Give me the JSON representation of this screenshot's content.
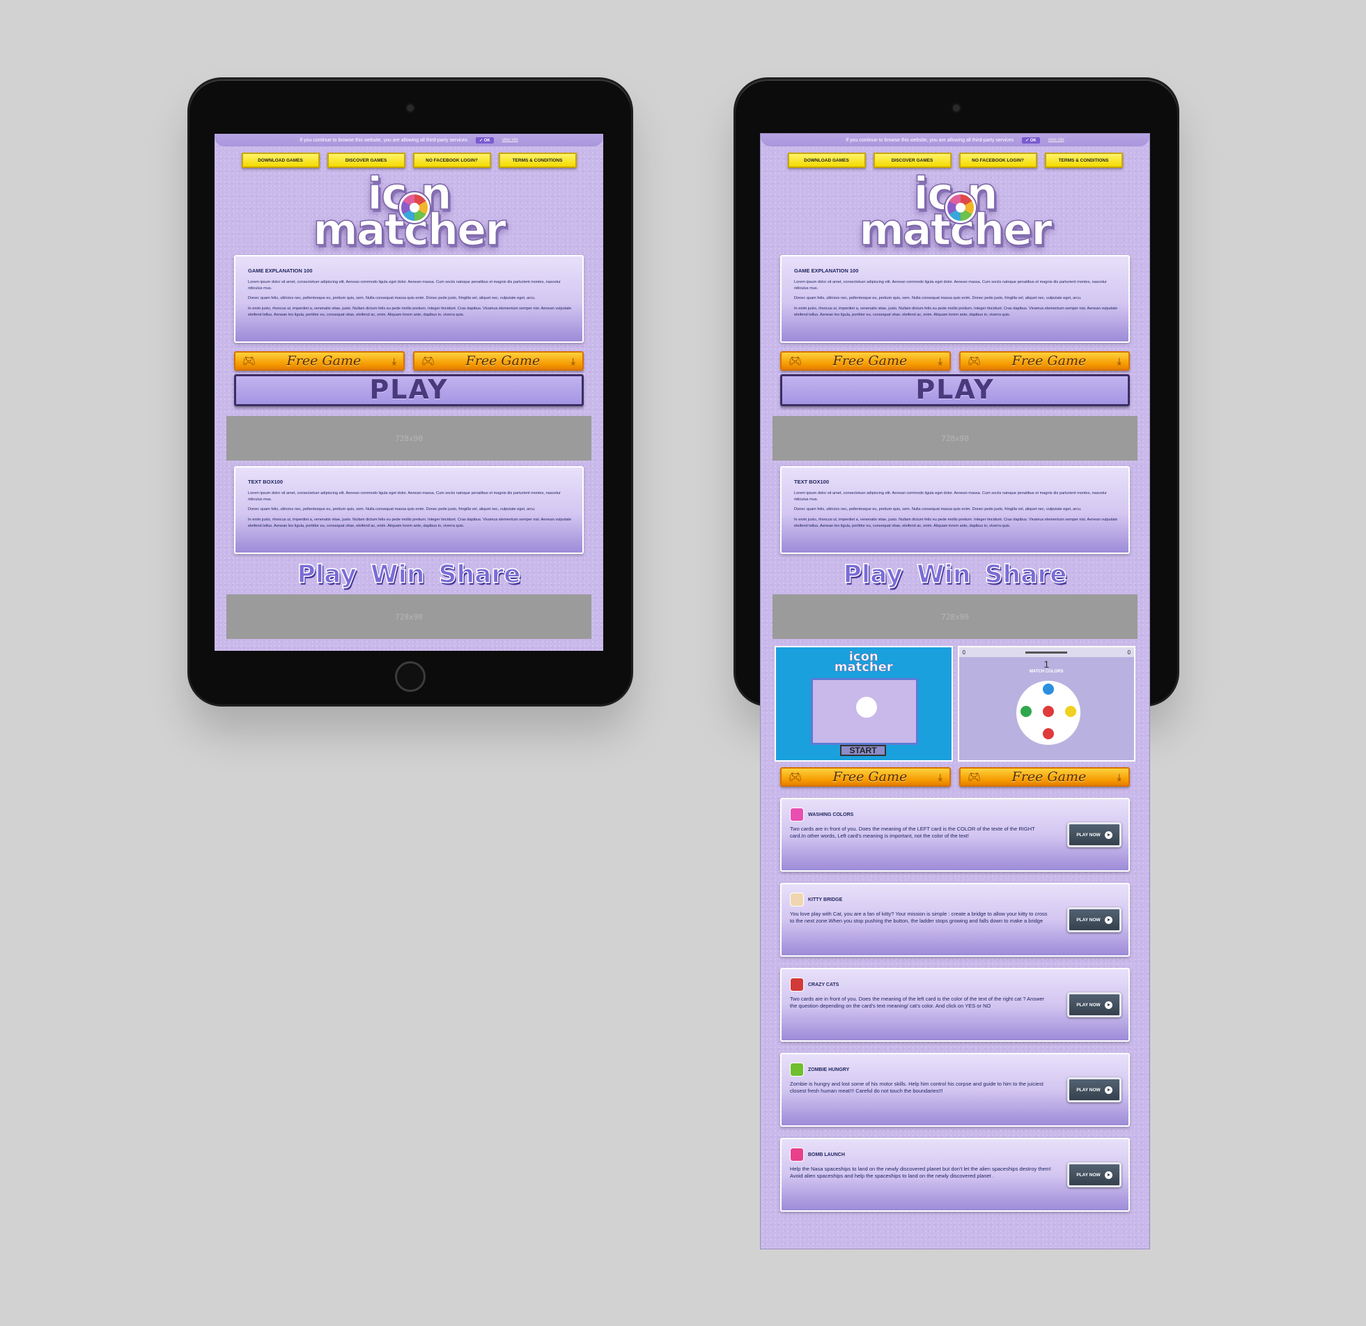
{
  "cookie": {
    "text": "If you continue to browse this website, you are allowing all third-party services",
    "ok": "✓ OK",
    "more": "view site"
  },
  "nav": [
    "DOWNLOAD GAMES",
    "DISCOVER GAMES",
    "NO FACEBOOK LOGIN?",
    "TERMS & CONDITIONS"
  ],
  "logo": {
    "line1": "ic n",
    "line2": "matcher"
  },
  "game_box": {
    "title": "GAME EXPLANATION 100",
    "p1": "Lorem ipsum dolor sit amet, consectetuer adipiscing elit. Aenean commodo ligula eget dolor. Aenean massa. Cum sociis natoque penatibus et magnis dis parturient montes, nascetur ridiculus mus.",
    "p2": "Donec quam felis, ultricies nec, pellentesque eu, pretium quis, sem. Nulla consequat massa quis enim. Donec pede justo, fringilla vel, aliquet nec, vulputate eget, arcu.",
    "p3": "In enim justo, rhoncus ut, imperdiet a, venenatis vitae, justo. Nullam dictum felis eu pede mollis pretium. Integer tincidunt. Cras dapibus. Vivamus elementum semper nisi. Aenean vulputate eleifend tellus. Aenean leo ligula, porttitor eu, consequat vitae, eleifend ac, enim. Aliquam lorem ante, dapibus in, viverra quis."
  },
  "text_box": {
    "title": "TEXT BOX100",
    "p1": "Lorem ipsum dolor sit amet, consectetuer adipiscing elit. Aenean commodo ligula eget dolor. Aenean massa. Cum sociis natoque penatibus et magnis dis parturient montes, nascetur ridiculus mus.",
    "p2": "Donec quam felis, ultricies nec, pellentesque eu, pretium quis, sem. Nulla consequat massa quis enim. Donec pede justo, fringilla vel, aliquet nec, vulputate eget, arcu.",
    "p3": "In enim justo, rhoncus ut, imperdiet a, venenatis vitae, justo. Nullam dictum felis eu pede mollis pretium. Integer tincidunt. Cras dapibus. Vivamus elementum semper nisi. Aenean vulputate eleifend tellus. Aenean leo ligula, porttitor eu, consequat vitae, eleifend ac, enim. Aliquam lorem ante, dapibus in, viverra quis."
  },
  "free_game_label": "Free Game",
  "play_label": "PLAY",
  "ad_label": "728x90",
  "tagline": {
    "w1": "Play",
    "w2": "Win",
    "w3": "Share"
  },
  "preview": {
    "logo_line1": "icon",
    "logo_line2": "matcher",
    "start": "START",
    "hud_left": "0",
    "hud_right": "0",
    "round": "1",
    "match_colors": "MATCH COLORS"
  },
  "play_now": "PLAY NOW",
  "games": [
    {
      "title": "WASHING COLORS",
      "desc": "Two cards are in front of you. Does the meaning of the LEFT card is the COLOR of the texte of the RIGHT card.In other words, Left card's meaning is important, not the color of the text!",
      "icon_color": "#e84fb0"
    },
    {
      "title": "KITTY BRIDGE",
      "desc": "You love play with Cat, you are a fan of kitty? Your mission is simple : create a bridge to allow your kitty to cross to the next zone.When you stop pushing the button, the ladder stops growing and falls down to make a bridge",
      "icon_color": "#f0d6b0"
    },
    {
      "title": "CRAZY CATS",
      "desc": "Two cards are in front of you. Does the meaning of the left card is the color of the text of the right cat ? Answer the question depending on the card's text meaning/ cat's color. And click on YES or NO",
      "icon_color": "#d23a3a"
    },
    {
      "title": "ZOMBIE HUNGRY",
      "desc": "Zombie is hungry and lost some of his motor skills. Help him control his corpse and guide to him to the juiciest closest fresh human meat!!! Careful do not touch the boundaries!!!",
      "icon_color": "#6fbf2e"
    },
    {
      "title": "BOMB LAUNCH",
      "desc": "Help the Nasa spaceships to land on the newly discovered planet but don't let the alien spaceships destroy them! Avoid alien spaceships and help the spaceships to land on the newly discovered planet .",
      "icon_color": "#e8408a"
    }
  ],
  "colors": {
    "accent": "#c9b8ea",
    "nav_yellow": "#f3da00",
    "free_orange": "#f59a00",
    "play_dark": "#3c2d64"
  }
}
